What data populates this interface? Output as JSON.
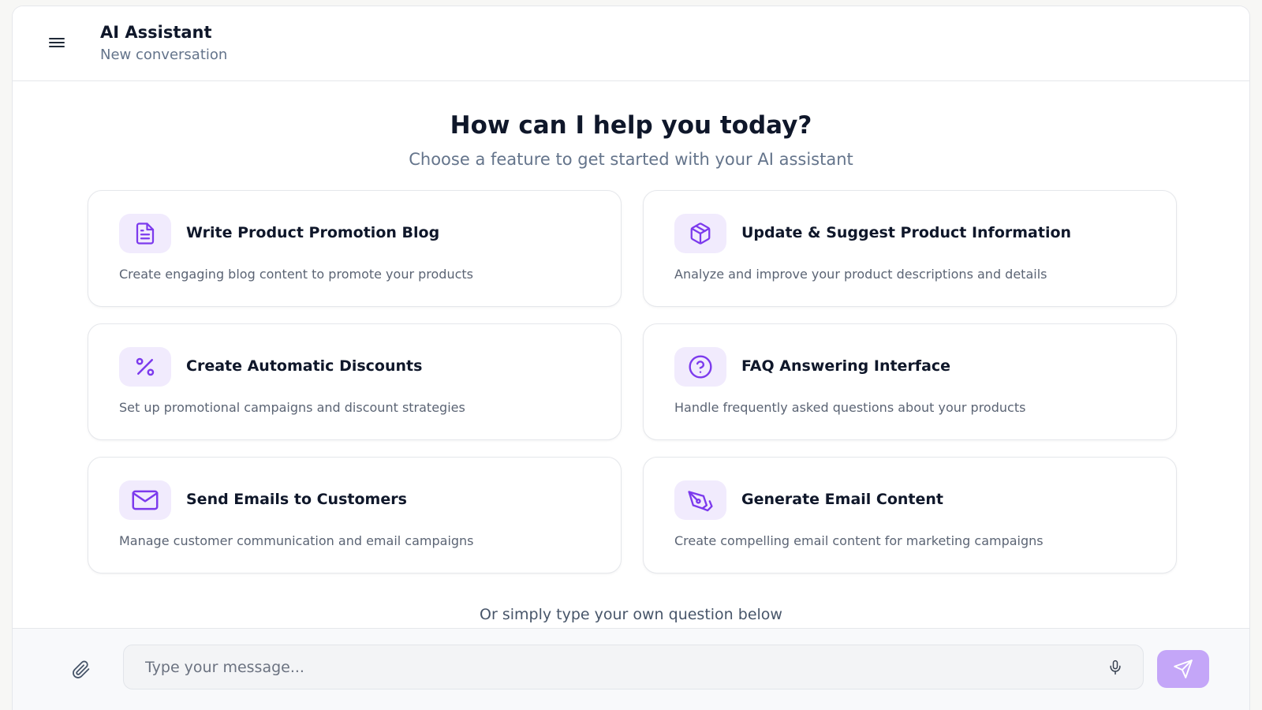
{
  "header": {
    "title": "AI Assistant",
    "subtitle": "New conversation",
    "menu_icon": "hamburger-menu-icon"
  },
  "main": {
    "headline": "How can I help you today?",
    "subheadline": "Choose a feature to get started with your AI assistant",
    "features": [
      {
        "title": "Write Product Promotion Blog",
        "description": "Create engaging blog content to promote your products",
        "icon": "document-icon"
      },
      {
        "title": "Update & Suggest Product Information",
        "description": "Analyze and improve your product descriptions and details",
        "icon": "package-icon"
      },
      {
        "title": "Create Automatic Discounts",
        "description": "Set up promotional campaigns and discount strategies",
        "icon": "percent-icon"
      },
      {
        "title": "FAQ Answering Interface",
        "description": "Handle frequently asked questions about your products",
        "icon": "question-circle-icon"
      },
      {
        "title": "Send Emails to Customers",
        "description": "Manage customer communication and email campaigns",
        "icon": "mail-icon"
      },
      {
        "title": "Generate Email Content",
        "description": "Create compelling email content for marketing campaigns",
        "icon": "pen-tool-icon"
      }
    ],
    "hint": "Or simply type your own question below"
  },
  "composer": {
    "placeholder": "Type your message...",
    "value": "",
    "attach_icon": "paperclip-icon",
    "mic_icon": "microphone-icon",
    "send_icon": "send-icon"
  },
  "colors": {
    "accent": "#7c3aed",
    "icon_bg": "#f1ebfd",
    "send_button": "#c4a6f8"
  }
}
